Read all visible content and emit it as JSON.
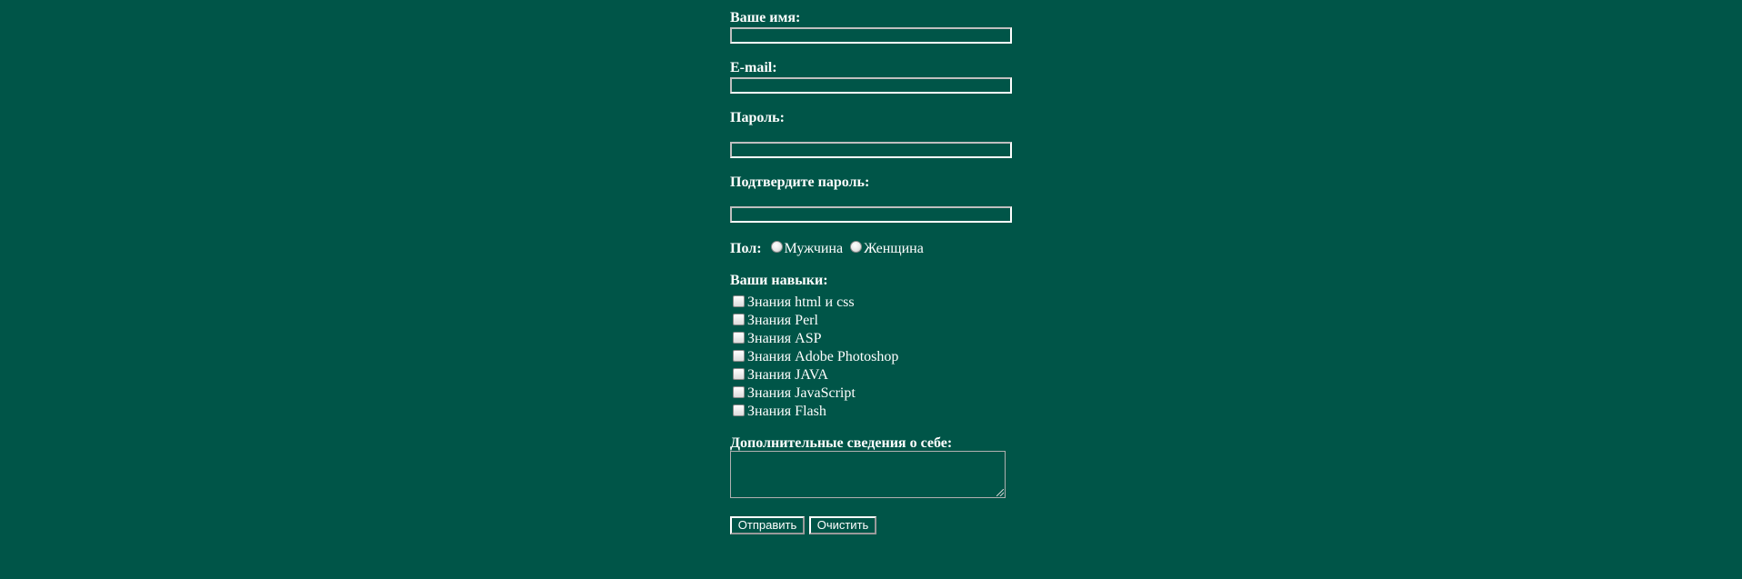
{
  "form": {
    "name_label": "Ваше имя:",
    "name_value": "",
    "email_label": "E-mail:",
    "email_value": "",
    "password_label": "Пароль:",
    "password_value": "",
    "confirm_label": "Подтвердите пароль:",
    "confirm_value": "",
    "gender": {
      "label": "Пол:",
      "options": [
        "Мужчина",
        "Женщина"
      ]
    },
    "skills": {
      "label": "Ваши навыки:",
      "items": [
        "Знания html и css",
        "Знания Perl",
        "Знания ASP",
        "Знания Adobe Photoshop",
        "Знания JAVA",
        "Знания JavaScript",
        "Знания Flash"
      ]
    },
    "about_label": "Дополнительные сведения о себе:",
    "about_value": "",
    "submit_label": "Отправить",
    "reset_label": "Очистить"
  }
}
